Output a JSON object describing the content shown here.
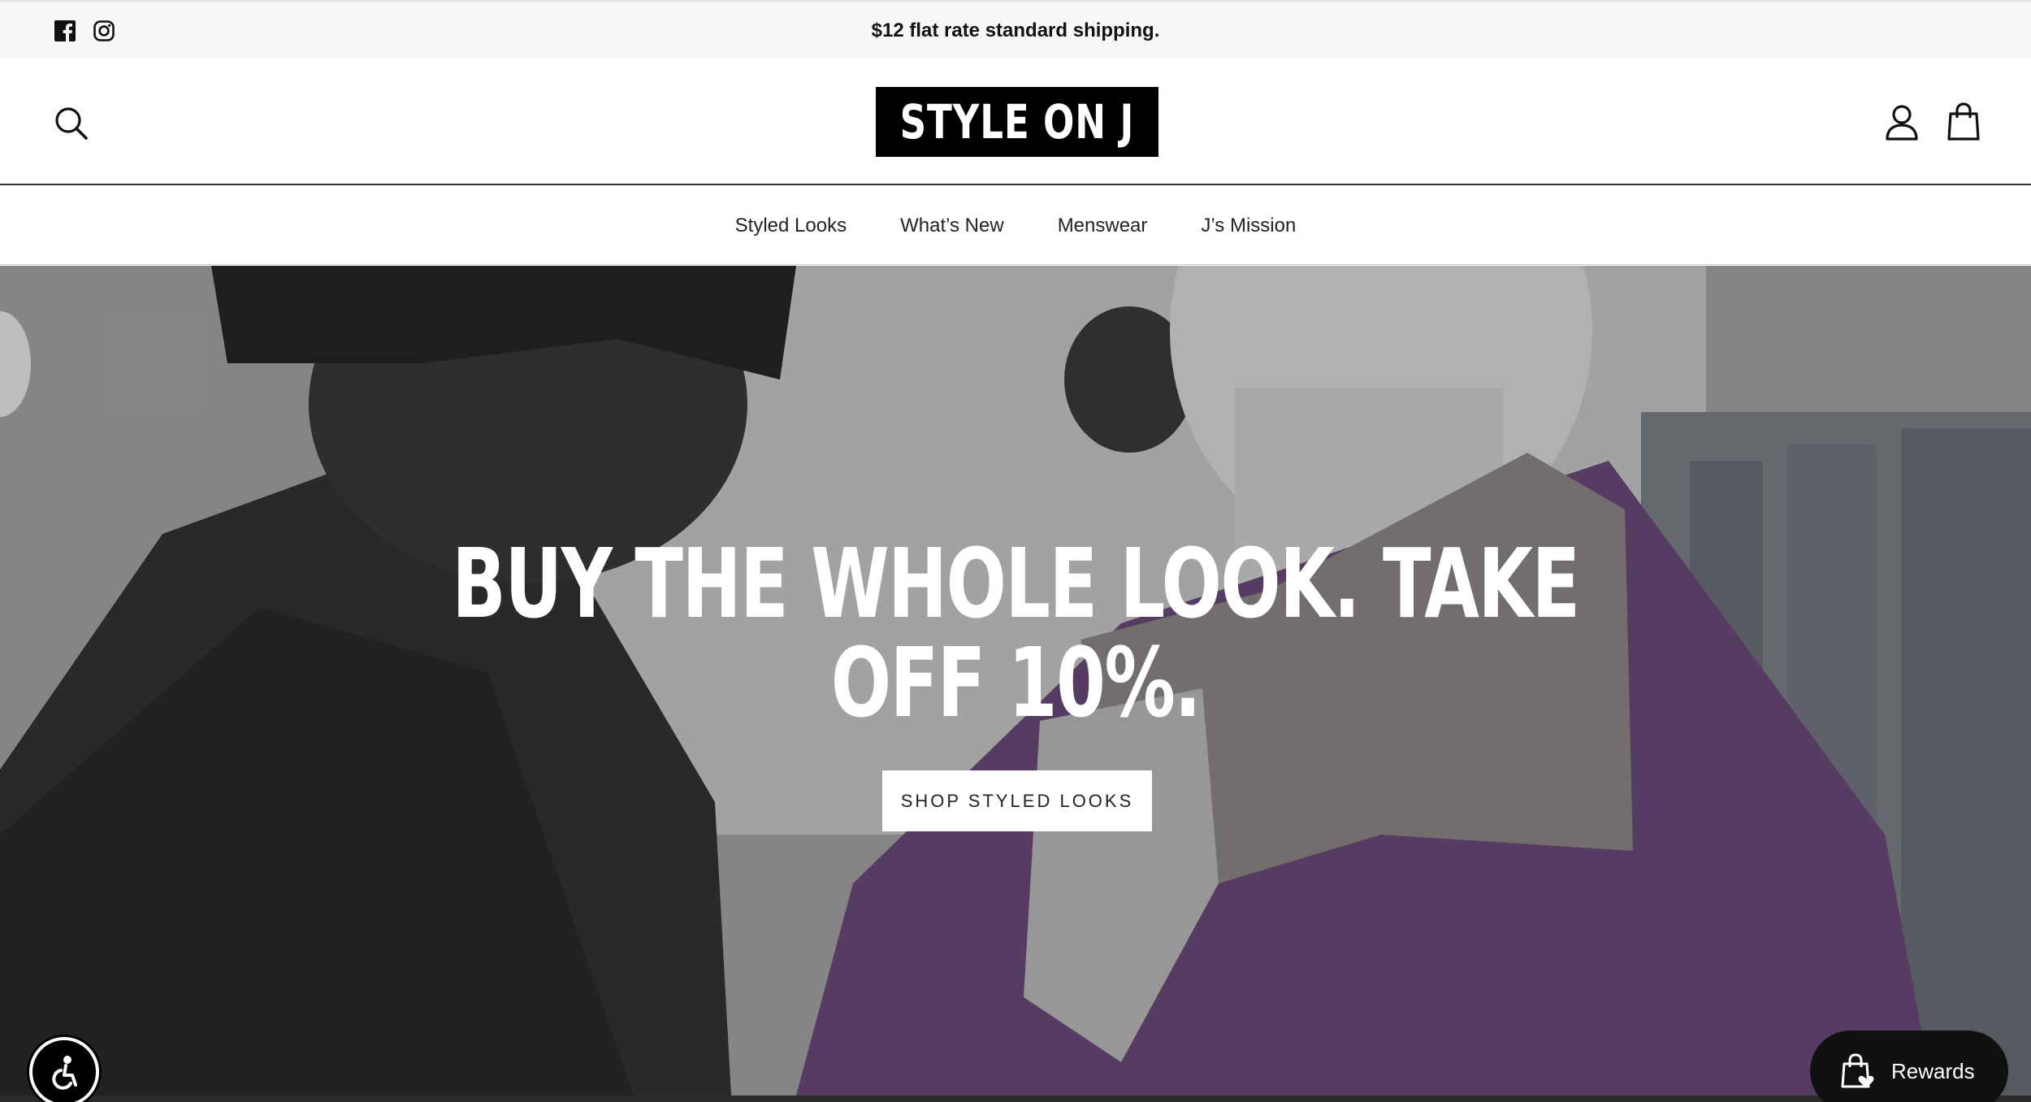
{
  "announcement": {
    "text": "$12 flat rate standard shipping.",
    "social": [
      "facebook-icon",
      "instagram-icon"
    ]
  },
  "header": {
    "logo_text": "STYLE ON J",
    "icons": [
      "search-icon",
      "account-icon",
      "cart-icon"
    ]
  },
  "nav": {
    "items": [
      {
        "label": "Styled Looks"
      },
      {
        "label": "What’s New"
      },
      {
        "label": "Menswear"
      },
      {
        "label": "J’s Mission"
      }
    ]
  },
  "hero": {
    "title_line1": "BUY THE WHOLE LOOK. TAKE",
    "title_line2": "OFF 10%.",
    "cta_label": "SHOP STYLED LOOKS"
  },
  "widgets": {
    "accessibility_icon": "accessibility-icon",
    "rewards_label": "Rewards",
    "rewards_icon": "shopping-bag-heart-icon"
  },
  "colors": {
    "announcement_bg": "#f7f7f7",
    "logo_bg": "#000000",
    "logo_text": "#ffffff",
    "sweater_purple": "#6a4a78",
    "rewards_bg": "#111111"
  }
}
